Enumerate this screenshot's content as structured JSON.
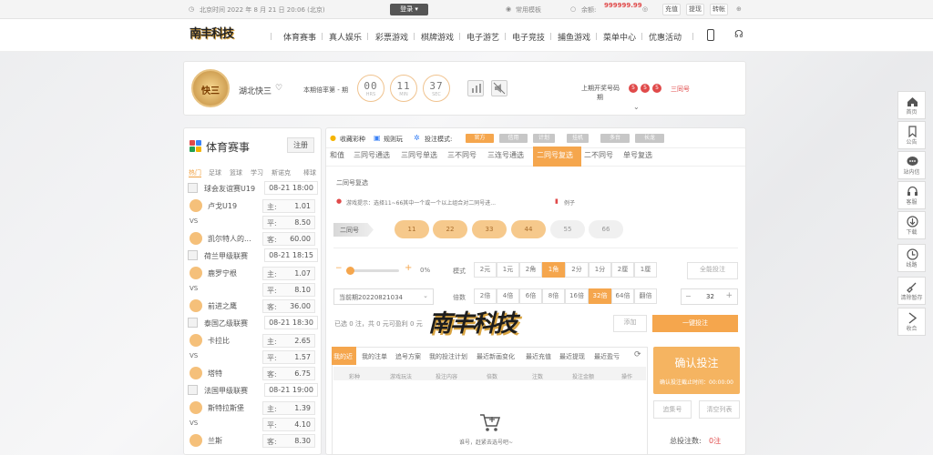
{
  "topbar": {
    "time_label": "北京时间 2022 年 8 月 21 日 20:06 (北京)",
    "login_btn": "登录",
    "mode_label": "常用模板",
    "balance_label": "余额:",
    "balance_value": "999999.99",
    "recharge": "充值",
    "withdraw": "提现",
    "transfer": "转帐"
  },
  "nav": {
    "logo_text": "南丰科技",
    "items": [
      "体育赛事",
      "真人娱乐",
      "彩票游戏",
      "棋牌游戏",
      "电子游艺",
      "电子竞技",
      "捕鱼游戏",
      "菜单中心",
      "优惠活动"
    ]
  },
  "lottery": {
    "emblem": "快三",
    "name": "湖北快三",
    "period_label": "本期倍率第 - 期",
    "hours": "00",
    "hours_unit": "HRS",
    "minutes": "11",
    "minutes_unit": "MIN",
    "seconds": "37",
    "seconds_unit": "SEC",
    "last_label": "上期开奖号码",
    "last_label2": "期",
    "last_numbers": [
      "5",
      "5",
      "5"
    ],
    "last_result": "三同号"
  },
  "sports": {
    "title": "体育赛事",
    "register_btn": "注册",
    "tabs": [
      "热门",
      "足球",
      "篮球",
      "学习",
      "斯诺克",
      "棒球"
    ],
    "matches": [
      {
        "league": "球会友谊赛U19",
        "time": "08-21 18:00",
        "home": "卢戈U19",
        "vs": "VS",
        "away": "凯尔特人的...",
        "odds": [
          {
            "k": "主:",
            "v": "1.01"
          },
          {
            "k": "平:",
            "v": "8.50"
          },
          {
            "k": "客:",
            "v": "60.00"
          }
        ]
      },
      {
        "league": "荷兰甲级联赛",
        "time": "08-21 18:15",
        "home": "鹿罗宁根",
        "vs": "VS",
        "away": "前进之鹰",
        "odds": [
          {
            "k": "主:",
            "v": "1.07"
          },
          {
            "k": "平:",
            "v": "8.10"
          },
          {
            "k": "客:",
            "v": "36.00"
          }
        ]
      },
      {
        "league": "泰国乙级联赛",
        "time": "08-21 18:30",
        "home": "卡拉比",
        "vs": "VS",
        "away": "塔特",
        "odds": [
          {
            "k": "主:",
            "v": "2.65"
          },
          {
            "k": "平:",
            "v": "1.57"
          },
          {
            "k": "客:",
            "v": "6.75"
          }
        ]
      },
      {
        "league": "法国甲级联赛",
        "time": "08-21 19:00",
        "home": "斯特拉斯堡",
        "vs": "VS",
        "away": "兰斯",
        "odds": [
          {
            "k": "主:",
            "v": "1.39"
          },
          {
            "k": "平:",
            "v": "4.10"
          },
          {
            "k": "客:",
            "v": "8.30"
          }
        ]
      }
    ]
  },
  "game": {
    "fav": "收藏彩种",
    "rules": "规则玩",
    "mode_label": "投注模式:",
    "modes": [
      "官方",
      "信用",
      "计划",
      "挂机",
      "多台",
      "长龙"
    ],
    "tabs": [
      "和值",
      "三同号通选",
      "三同号单选",
      "三不同号",
      "三连号通选",
      "二同号复选",
      "二不同号",
      "单号复选"
    ],
    "section_title": "二同号复选",
    "tip": "游戏提示：选择11~66其中一个或一个以上组合对二同号进...",
    "example": "例子",
    "row_label": "二同号",
    "numbers": [
      "11",
      "22",
      "33",
      "44",
      "55",
      "66"
    ],
    "slider_pct": "0%",
    "mode_row_label": "模式",
    "unit_opts": [
      "2元",
      "1元",
      "2角",
      "1角",
      "2分",
      "1分",
      "2厘",
      "1厘"
    ],
    "period_select": "当前期20220821034",
    "mult_label": "倍数",
    "mult_opts": [
      "2倍",
      "4倍",
      "6倍",
      "8倍",
      "16倍",
      "32倍",
      "64倍",
      "翻倍"
    ],
    "full_bet": "全能投注",
    "qty": "32",
    "summary": "已选 0 注，共 0 元可盈利 0 元",
    "add_btn": "添加",
    "one_click": "一键投注",
    "history_tabs": [
      "我的近",
      "我的注单",
      "追号方案",
      "我的投注计划",
      "最近新画变化",
      "最近充值",
      "最近提现",
      "最近盈亏"
    ],
    "columns": [
      "彩种",
      "游戏玩法",
      "投注内容",
      "倍数",
      "注数",
      "投注金额",
      "操作"
    ],
    "empty_text": "谁号，赶紧去选号吧~",
    "confirm": "确认投注",
    "deadline": "确认投注截止时间：00:00:00",
    "chase": "追集号",
    "clear": "清空列表",
    "total_label": "总投注数:",
    "total_value": "0注"
  },
  "sidebar": [
    "首页",
    "公告",
    "站内信",
    "客服",
    "下载",
    "线路",
    "清除暂存",
    "收合"
  ],
  "watermark": "南丰科技",
  "colors": {
    "accent": "#f5a64d",
    "red": "#e04a4a"
  }
}
